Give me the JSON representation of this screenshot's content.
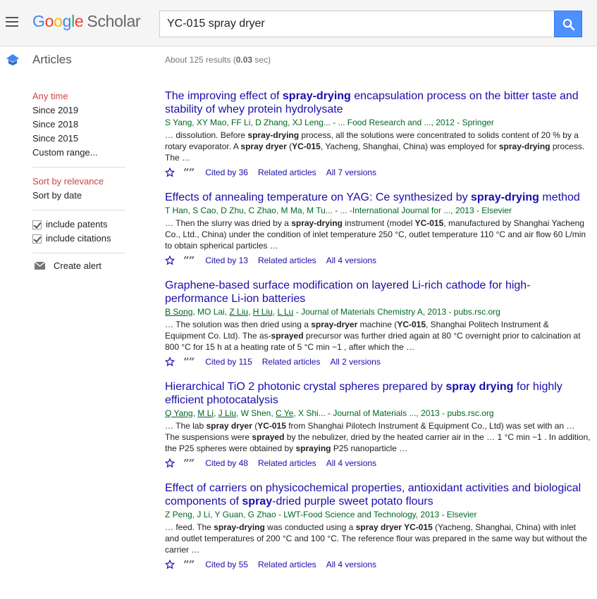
{
  "header": {
    "logo_letters": [
      "G",
      "o",
      "o",
      "g",
      "l",
      "e"
    ],
    "logo_suffix": "Scholar",
    "search_value": "YC-015 spray dryer"
  },
  "subheader": {
    "section": "Articles",
    "count_prefix": "About 125 results (",
    "count_time": "0.03",
    "count_suffix": " sec)"
  },
  "sidebar": {
    "time_filters": [
      "Any time",
      "Since 2019",
      "Since 2018",
      "Since 2015",
      "Custom range..."
    ],
    "sort_options": [
      "Sort by relevance",
      "Sort by date"
    ],
    "checks": [
      "include patents",
      "include citations"
    ],
    "create_alert": "Create alert"
  },
  "results": [
    {
      "title": [
        [
          "The improving effect of ",
          false
        ],
        [
          "spray-drying",
          true
        ],
        [
          " encapsulation process on the bitter taste and stability of whey protein hydrolysate",
          false
        ]
      ],
      "authors": [
        [
          "S Yang, XY Mao, FF Li, D Zhang, XJ Leng",
          false
        ],
        [
          "... - ... Food Research and ..., 2012 - Springer",
          false
        ]
      ],
      "snippet": [
        [
          "… dissolution. Before ",
          false
        ],
        [
          "spray-drying",
          true
        ],
        [
          " process, all the solutions were concentrated to solids content of 20 % by a rotary evaporator. A ",
          false
        ],
        [
          "spray dryer",
          true
        ],
        [
          " (",
          false
        ],
        [
          "YC-015",
          true
        ],
        [
          ", Yacheng, Shanghai, China) was employed for ",
          false
        ],
        [
          "spray-drying",
          true
        ],
        [
          " process. The …",
          false
        ]
      ],
      "cited": "Cited by 36",
      "related": "Related articles",
      "versions": "All 7 versions"
    },
    {
      "title": [
        [
          "Effects of annealing temperature on YAG: Ce synthesized by ",
          false
        ],
        [
          "spray-drying",
          true
        ],
        [
          " method",
          false
        ]
      ],
      "authors": [
        [
          "T Han, S Cao, D Zhu, C Zhao, M Ma, M Tu",
          false
        ],
        [
          "... - ... -International Journal for ..., 2013 - Elsevier",
          false
        ]
      ],
      "snippet": [
        [
          "… Then the slurry was dried by a ",
          false
        ],
        [
          "spray-drying",
          true
        ],
        [
          " instrument (model ",
          false
        ],
        [
          "YC-015",
          true
        ],
        [
          ", manufactured by Shanghai Yacheng Co., Ltd., China) under the condition of inlet temperature 250 °C, outlet temperature 110 °C and air flow 60 L/min to obtain spherical particles …",
          false
        ]
      ],
      "cited": "Cited by 13",
      "related": "Related articles",
      "versions": "All 4 versions"
    },
    {
      "title": [
        [
          "Graphene-based surface modification on layered Li-rich cathode for high-performance Li-ion batteries",
          false
        ]
      ],
      "authors": [
        [
          "B Song",
          true
        ],
        [
          ", MO Lai, ",
          false
        ],
        [
          "Z Liu",
          true
        ],
        [
          ", ",
          false
        ],
        [
          "H Liu",
          true
        ],
        [
          ", ",
          false
        ],
        [
          "L Lu",
          true
        ],
        [
          " - Journal of Materials Chemistry A, 2013 - pubs.rsc.org",
          false
        ]
      ],
      "snippet": [
        [
          "… The solution was then dried using a ",
          false
        ],
        [
          "spray-dryer",
          true
        ],
        [
          " machine (",
          false
        ],
        [
          "YC-015",
          true
        ],
        [
          ", Shanghai Politech Instrument & Equipment Co. Ltd). The as-",
          false
        ],
        [
          "sprayed",
          true
        ],
        [
          " precursor was further dried again at 80 °C overnight prior to calcination at 800 °C for 15 h at a heating rate of 5 °C min −1 , after which the …",
          false
        ]
      ],
      "cited": "Cited by 115",
      "related": "Related articles",
      "versions": "All 2 versions"
    },
    {
      "title": [
        [
          "Hierarchical TiO 2 photonic crystal spheres prepared by ",
          false
        ],
        [
          "spray drying",
          true
        ],
        [
          " for highly efficient photocatalysis",
          false
        ]
      ],
      "authors": [
        [
          "Q Yang",
          true
        ],
        [
          ", ",
          false
        ],
        [
          "M Li",
          true
        ],
        [
          ", ",
          false
        ],
        [
          "J Liu",
          true
        ],
        [
          ", W Shen, ",
          false
        ],
        [
          "C Ye",
          true
        ],
        [
          ", X Shi",
          false
        ],
        [
          "... - Journal of Materials ..., 2013 - pubs.rsc.org",
          false
        ]
      ],
      "snippet": [
        [
          "… The lab ",
          false
        ],
        [
          "spray dryer",
          true
        ],
        [
          " (",
          false
        ],
        [
          "YC-015",
          true
        ],
        [
          " from Shanghai Pilotech Instrument & Equipment Co., Ltd) was set with an … The suspensions were ",
          false
        ],
        [
          "sprayed",
          true
        ],
        [
          " by the nebulizer, dried by the heated carrier air in the … 1 °C min −1 . In addition, the P25 spheres were obtained by ",
          false
        ],
        [
          "spraying",
          true
        ],
        [
          " P25 nanoparticle …",
          false
        ]
      ],
      "cited": "Cited by 48",
      "related": "Related articles",
      "versions": "All 4 versions"
    },
    {
      "title": [
        [
          "Effect of carriers on physicochemical properties, antioxidant activities and biological components of ",
          false
        ],
        [
          "spray",
          true
        ],
        [
          "-dried purple sweet potato flours",
          false
        ]
      ],
      "authors": [
        [
          "Z Peng, J Li, Y Guan, G Zhao - LWT-Food Science and Technology, 2013 - Elsevier",
          false
        ]
      ],
      "snippet": [
        [
          "… feed. The ",
          false
        ],
        [
          "spray-drying",
          true
        ],
        [
          " was conducted using a ",
          false
        ],
        [
          "spray dryer YC-015",
          true
        ],
        [
          " (Yacheng, Shanghai, China) with inlet and outlet temperatures of 200 °C and 100 °C. The reference flour was prepared in the same way but without the carrier …",
          false
        ]
      ],
      "cited": "Cited by 55",
      "related": "Related articles",
      "versions": "All 4 versions"
    }
  ]
}
